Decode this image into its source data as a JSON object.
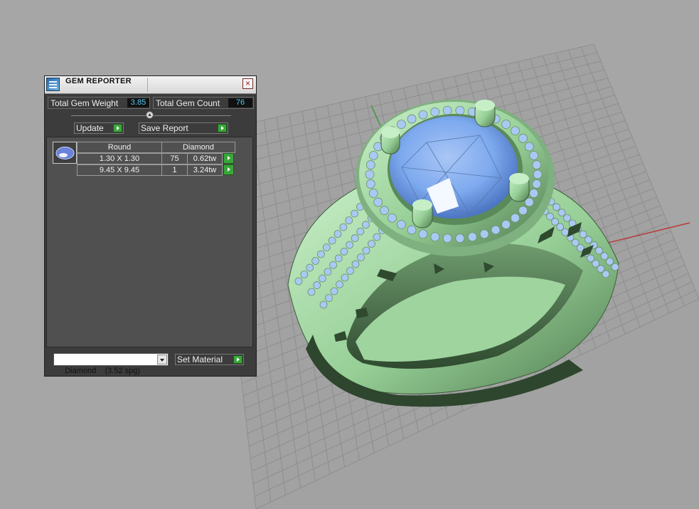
{
  "panel": {
    "title": "GEM REPORTER",
    "close_glyph": "×",
    "icons": {
      "app": "gem-reporter-app-icon",
      "close": "close-icon",
      "go": "play-arrow-icon",
      "dropdown": "chevron-down-icon",
      "gem": "round-gem-icon"
    },
    "total_gem_weight": {
      "label": "Total Gem Weight",
      "value": "3.85"
    },
    "total_gem_count": {
      "label": "Total Gem Count",
      "value": "76"
    },
    "update_label": "Update",
    "save_report_label": "Save Report",
    "table": {
      "shape_header": "Round",
      "material_header": "Diamond",
      "rows": [
        {
          "size": "1.30 X 1.30",
          "count": "75",
          "weight": "0.62tw"
        },
        {
          "size": "9.45 X 9.45",
          "count": "1",
          "weight": "3.24tw"
        }
      ]
    },
    "material_select_value": "Diamond    (3.52 spg)",
    "set_material_label": "Set Material"
  },
  "colors": {
    "viewport_bg": "#a6a6a6",
    "grid_line": "#8e8e8e",
    "axis_red": "#b83a3a",
    "axis_green": "#3a9a3a",
    "ring_metal": "#9ed69e",
    "gem_blue": "#7da9ee",
    "value_text": "#56c8f0",
    "go_button": "#3aa63a"
  }
}
